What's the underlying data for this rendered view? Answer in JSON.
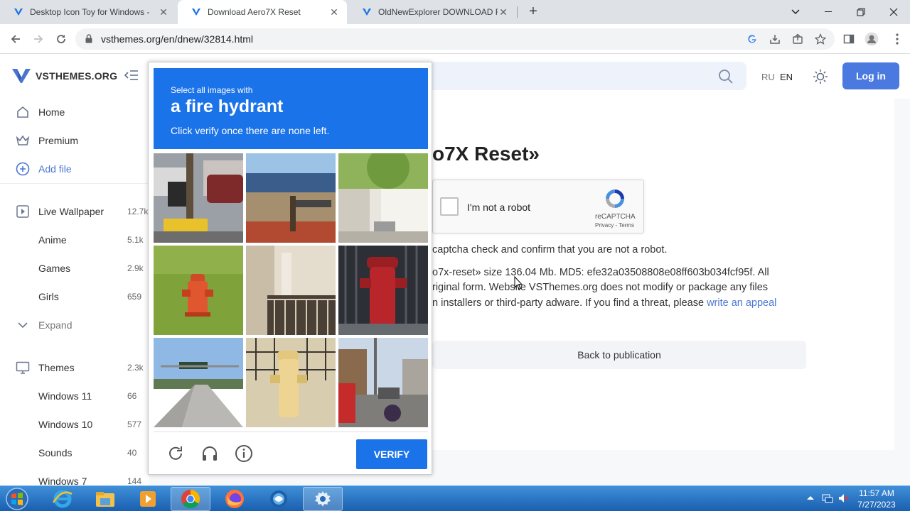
{
  "browser": {
    "tabs": [
      {
        "title": "Desktop Icon Toy for Windows - ",
        "active": false
      },
      {
        "title": "Download Aero7X Reset",
        "active": true
      },
      {
        "title": "OldNewExplorer DOWNLOAD FR",
        "active": false
      }
    ],
    "url": "vsthemes.org/en/dnew/32814.html"
  },
  "site": {
    "brand": "VSTHEMES.ORG",
    "nav": [
      {
        "label": "Home",
        "icon": "home-icon"
      },
      {
        "label": "Premium",
        "icon": "crown-icon"
      },
      {
        "label": "Add file",
        "icon": "plus-circle-icon"
      }
    ],
    "categories": [
      {
        "label": "Live Wallpaper",
        "count": "12.7k",
        "icon": "play-icon"
      },
      {
        "label": "Anime",
        "count": "5.1k"
      },
      {
        "label": "Games",
        "count": "2.9k"
      },
      {
        "label": "Girls",
        "count": "659"
      },
      {
        "label": "Expand",
        "icon": "chevron-down-icon"
      },
      {
        "label": "Themes",
        "count": "2.3k",
        "icon": "monitor-icon"
      },
      {
        "label": "Windows 11",
        "count": "66"
      },
      {
        "label": "Windows 10",
        "count": "577"
      },
      {
        "label": "Sounds",
        "count": "40"
      },
      {
        "label": "Windows 7",
        "count": "144"
      }
    ],
    "lang_ru": "RU",
    "lang_en": "EN",
    "login": "Log in"
  },
  "main": {
    "title_fragment": "o7X Reset»",
    "recaptcha_label": "I'm not a robot",
    "recaptcha_brand": "reCAPTCHA",
    "recaptcha_links": "Privacy - Terms",
    "line1": "captcha check and confirm that you are not a robot.",
    "line2": "o7x-reset» size 136.04 Mb. MD5: efe32a03508808e08ff603b034fcf95f. All",
    "line3": "riginal form. Website VSThemes.org does not modify or package any files",
    "line4": "n installers or third-party adware. If you find a threat, please",
    "appeal_link": "write an appeal",
    "back_button": "Back to publication"
  },
  "challenge": {
    "line1": "Select all images with",
    "line2": "a fire hydrant",
    "line3": "Click verify once there are none left.",
    "verify": "VERIFY"
  },
  "taskbar": {
    "time": "11:57 AM",
    "date": "7/27/2023"
  }
}
